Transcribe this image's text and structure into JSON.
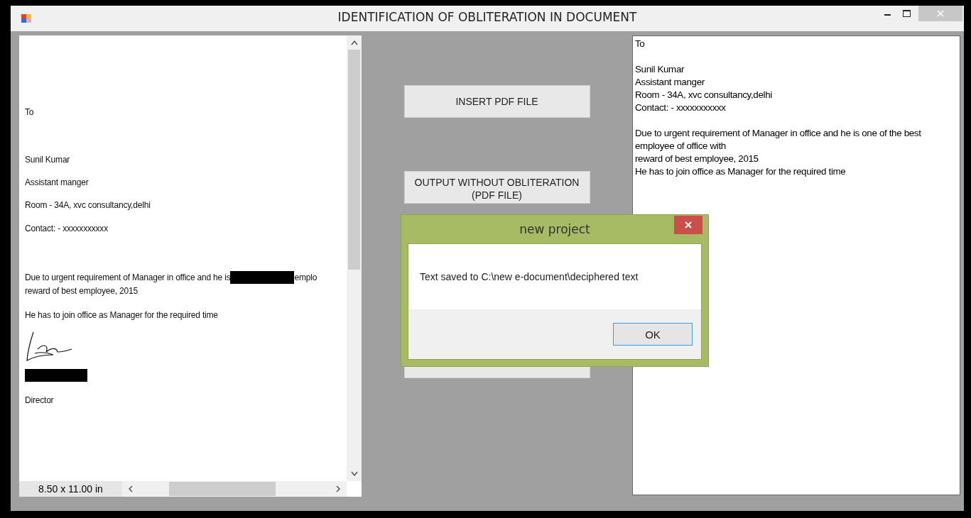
{
  "window": {
    "title": "IDENTIFICATION OF OBLITERATION IN DOCUMENT"
  },
  "left_document": {
    "lines": [
      {
        "kind": "text",
        "text": "To"
      },
      {
        "kind": "text",
        "text": "Sunil Kumar"
      },
      {
        "kind": "text",
        "text": "Assistant manger"
      },
      {
        "kind": "text",
        "text": "Room - 34A, xvc consultancy,delhi"
      },
      {
        "kind": "text",
        "text": "Contact: - xxxxxxxxxxx"
      },
      {
        "kind": "redacted_text",
        "before": "Due to urgent requirement of Manager in office and he is",
        "after": "emplo"
      },
      {
        "kind": "text",
        "text": "reward of best employee, 2015"
      },
      {
        "kind": "text",
        "text": "He has to join office as Manager for the required time"
      },
      {
        "kind": "signature"
      },
      {
        "kind": "redaction"
      },
      {
        "kind": "text",
        "text": "Director"
      }
    ],
    "page_size": "8.50 x 11.00 in"
  },
  "buttons": [
    {
      "lines": [
        "INSERT PDF FILE"
      ]
    },
    {
      "lines": [
        "OUTPUT WITHOUT OBLITERATION",
        "(PDF FILE)"
      ]
    }
  ],
  "output_text": {
    "paragraphs": [
      [
        "To"
      ],
      [
        "Sunil Kumar",
        "Assistant manger",
        "Room - 34A, xvc consultancy,delhi",
        "Contact: - xxxxxxxxxxx"
      ],
      [
        "Due to urgent requirement of Manager in office and he is one of the best",
        "employee of office with",
        "reward of best employee, 2015",
        "He has to join office as Manager for the required time"
      ]
    ]
  },
  "dialog": {
    "title": "new project",
    "message": "Text saved to C:\\new e-document\\deciphered text",
    "button": "OK"
  }
}
